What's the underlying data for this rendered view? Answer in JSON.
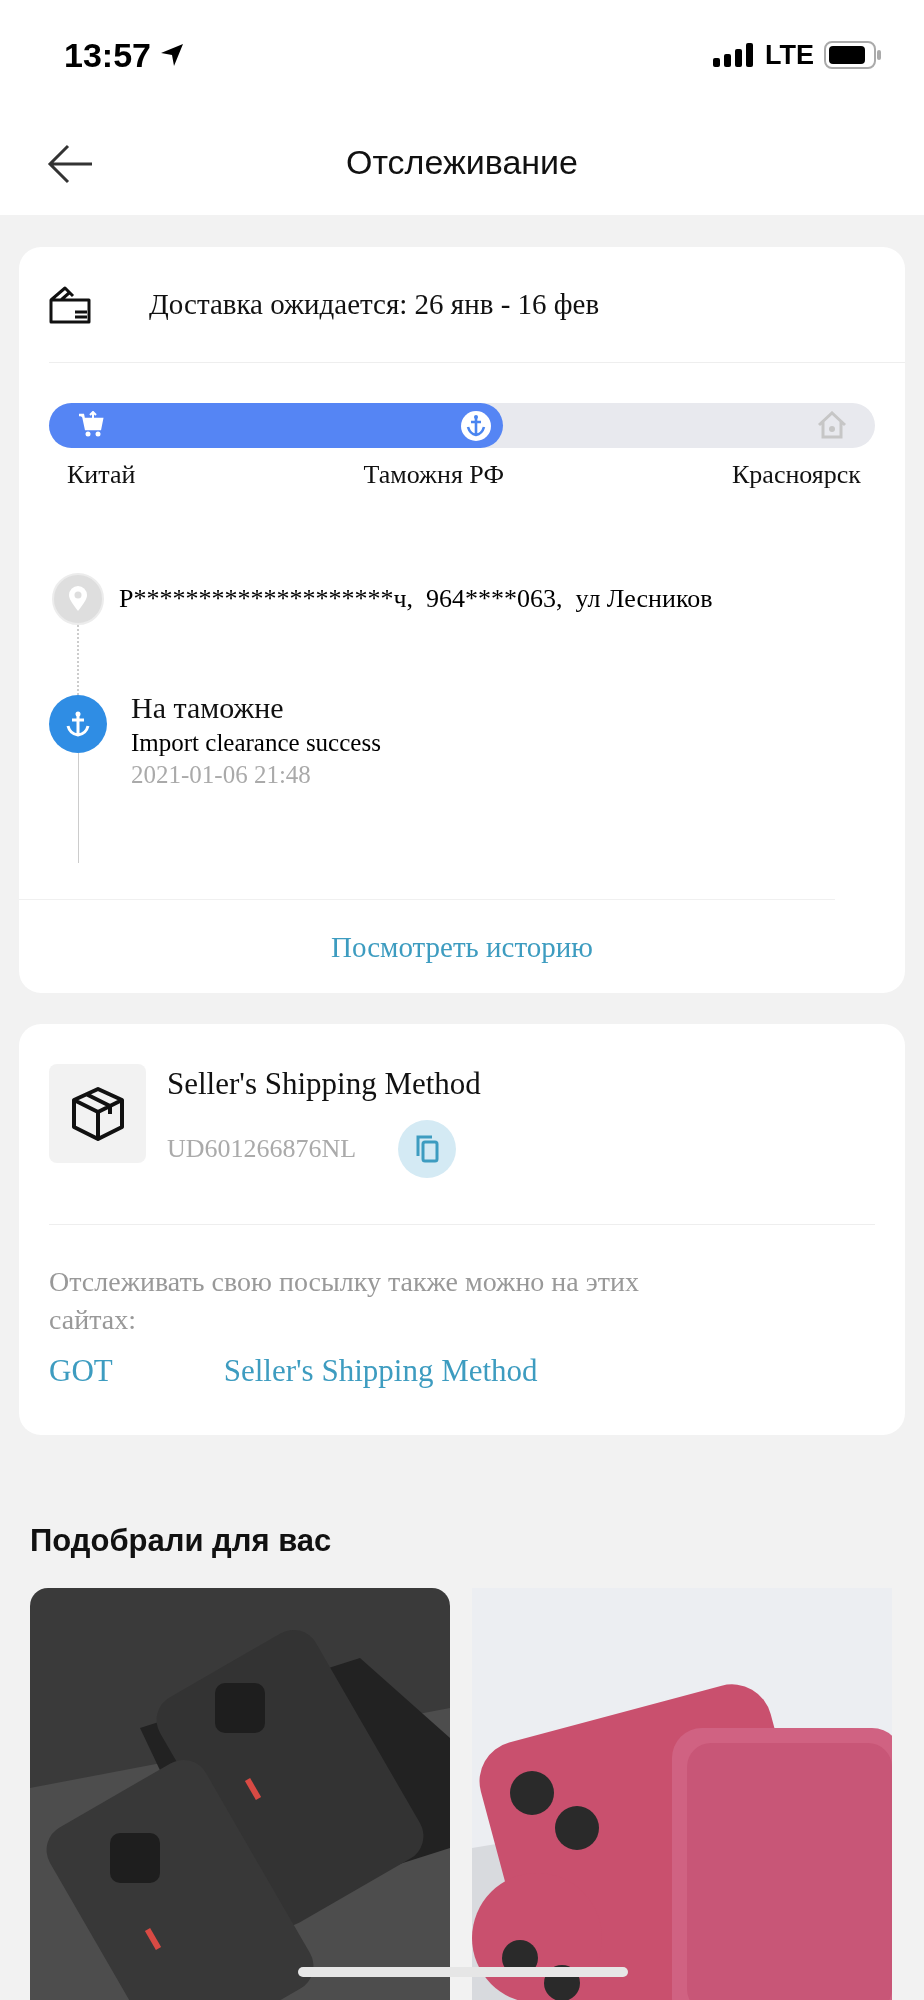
{
  "status_bar": {
    "time": "13:57",
    "network": "LTE"
  },
  "header": {
    "title": "Отслеживание"
  },
  "delivery": {
    "estimate": "Доставка ожидается: 26 янв - 16 фев",
    "progress": {
      "level": 0.55,
      "stages": [
        {
          "label": "Китай",
          "kind": "cart",
          "reached": true
        },
        {
          "label": "Таможня РФ",
          "kind": "anchor",
          "reached": true
        },
        {
          "label": "Красноярск",
          "kind": "house",
          "reached": false
        }
      ]
    },
    "timeline": [
      {
        "kind": "address",
        "text": "Р********************ч,  964****063,  ул Лесников"
      },
      {
        "kind": "event",
        "title": "На таможне",
        "detail": "Import clearance success",
        "time": "2021-01-06 21:48"
      }
    ],
    "history_link": "Посмотреть историю"
  },
  "shipping": {
    "method": "Seller's Shipping Method",
    "tracking_number": "UD601266876NL",
    "note": "Отслеживать свою посылку также можно на этих сайтах:",
    "sites": [
      "GOT",
      "Seller's Shipping Method"
    ]
  },
  "recommendations": {
    "title": "Подобрали для вас"
  }
}
